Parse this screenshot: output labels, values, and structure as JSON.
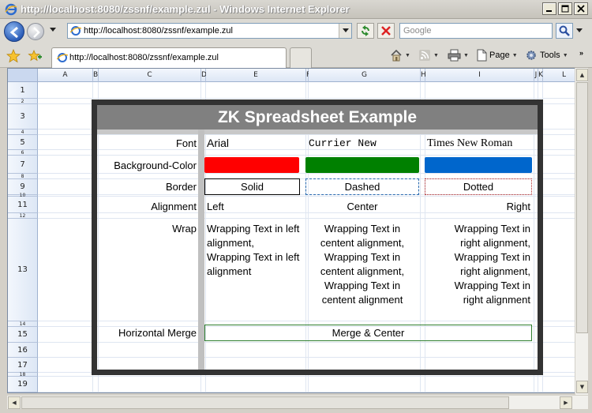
{
  "window": {
    "title": "http://localhost:8080/zssnf/example.zul - Windows Internet Explorer",
    "controls": [
      "minimize",
      "maximize",
      "close"
    ]
  },
  "navigation": {
    "address": "http://localhost:8080/zssnf/example.zul",
    "search_placeholder": "Google"
  },
  "tab": {
    "label": "http://localhost:8080/zssnf/example.zul"
  },
  "command_bar": {
    "page_label": "Page",
    "tools_label": "Tools"
  },
  "sheet": {
    "columns": [
      "A",
      "B",
      "C",
      "D",
      "E",
      "F",
      "G",
      "H",
      "I",
      "J",
      "K",
      "L"
    ],
    "rows": [
      "1",
      "2",
      "3",
      "4",
      "5",
      "6",
      "7",
      "8",
      "9",
      "10",
      "11",
      "12",
      "13",
      "14",
      "15",
      "16",
      "17",
      "18",
      "19"
    ],
    "title": "ZK Spreadsheet Example",
    "labels": {
      "font": "Font",
      "background": "Background-Color",
      "border": "Border",
      "alignment": "Alignment",
      "wrap": "Wrap",
      "merge": "Horizontal Merge"
    },
    "fonts": [
      "Arial",
      "Currier New",
      "Times New Roman"
    ],
    "colors": {
      "red": "#ff0000",
      "green": "#008000",
      "blue": "#0066cc"
    },
    "borders": [
      "Solid",
      "Dashed",
      "Dotted"
    ],
    "alignments": [
      "Left",
      "Center",
      "Right"
    ],
    "wrap_texts": [
      "Wrapping Text in left alignment, Wrapping Text in left alignment",
      "Wrapping Text in centent alignment, Wrapping Text in centent alignment, Wrapping Text in centent alignment",
      "Wrapping Text in right alignment, Wrapping Text in right alignment, Wrapping Text in right alignment"
    ],
    "merge_text": "Merge & Center"
  }
}
